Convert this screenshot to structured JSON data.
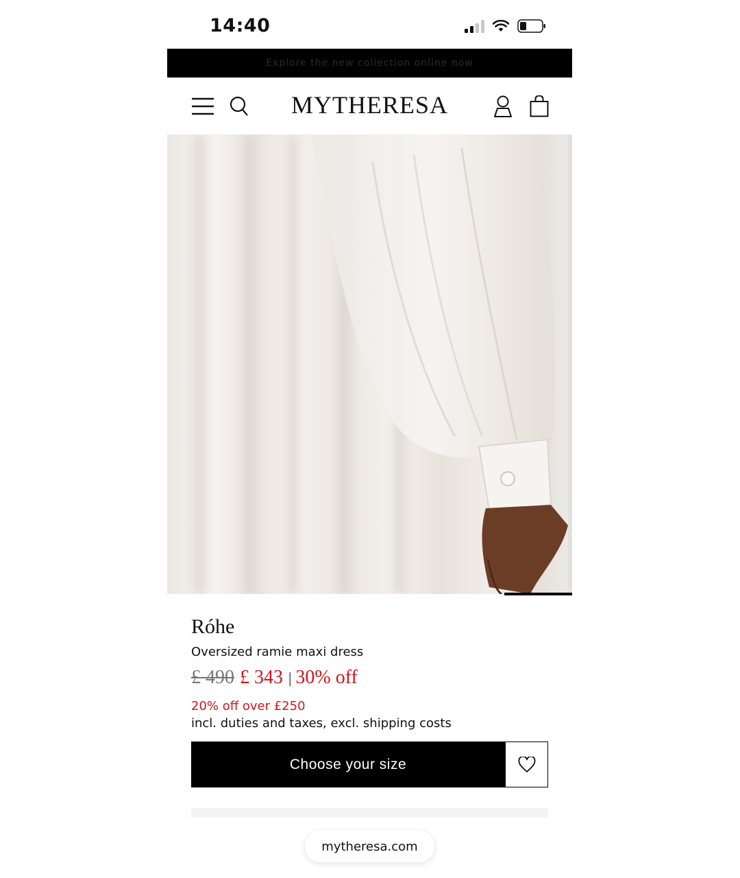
{
  "status_bar": {
    "time": "14:40",
    "signal_bars": 2,
    "battery_level": 0.3
  },
  "promo_banner": {
    "text": "Explore the new collection online now"
  },
  "header": {
    "logo": "MYTHERESA"
  },
  "product": {
    "brand": "Róhe",
    "name": "Oversized ramie maxi dress",
    "old_price": "£ 490",
    "new_price": "£ 343",
    "price_separator": "|",
    "discount": "30% off",
    "promo_note": "20% off over £250",
    "tax_note": "incl. duties and taxes, excl. shipping costs"
  },
  "actions": {
    "choose_size": "Choose your size"
  },
  "browser": {
    "url": "mytheresa.com"
  },
  "colors": {
    "sale_red": "#d0161b",
    "black": "#000000",
    "fabric": "#efebe7",
    "skin": "#6b3d26"
  }
}
